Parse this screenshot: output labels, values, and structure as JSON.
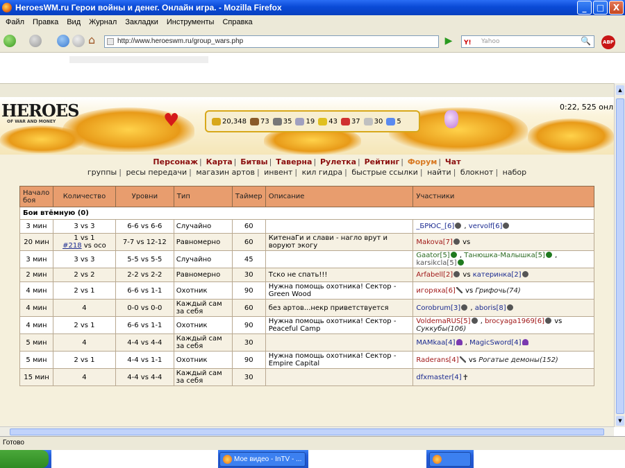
{
  "window": {
    "title": "HeroesWM.ru Герои войны и денег. Онлайн игра. - Mozilla Firefox",
    "buttons": [
      "_",
      "□",
      "X"
    ]
  },
  "menu": [
    "Файл",
    "Правка",
    "Вид",
    "Журнал",
    "Закладки",
    "Инструменты",
    "Справка"
  ],
  "navbar": {
    "url": "http://www.heroeswm.ru/group_wars.php",
    "search_engine": "Y!",
    "search_placeholder": "Yahoo",
    "abp_label": "ABP"
  },
  "game": {
    "logo": "HEROES",
    "logo_sub": "OF WAR AND MONEY",
    "clock": "0:22, 525 онл",
    "resources": [
      {
        "name": "gold",
        "value": "20,348",
        "color": "#d8a81a"
      },
      {
        "name": "wood",
        "value": "73",
        "color": "#8a5a2a"
      },
      {
        "name": "ore",
        "value": "35",
        "color": "#777777"
      },
      {
        "name": "mercury",
        "value": "19",
        "color": "#a0a0c0"
      },
      {
        "name": "sulfur",
        "value": "43",
        "color": "#e0c020"
      },
      {
        "name": "crystals",
        "value": "37",
        "color": "#d03030"
      },
      {
        "name": "gems",
        "value": "30",
        "color": "#c0c0c0"
      },
      {
        "name": "diamonds",
        "value": "5",
        "color": "#5a8af0"
      }
    ],
    "main_nav": [
      "Персонаж",
      "Карта",
      "Битвы",
      "Таверна",
      "Рулетка",
      "Рейтинг",
      "Форум",
      "Чат"
    ],
    "sub_nav": [
      "группы",
      "ресы передачи",
      "магазин артов",
      "инвент",
      "кил гидра",
      "быстрые ссылки",
      "найти",
      "блокнот",
      "набор"
    ]
  },
  "table": {
    "headers": [
      "Начало боя",
      "Количество",
      "Уровни",
      "Тип",
      "Таймер",
      "Описание",
      "Участники"
    ],
    "group_label": "Бои втёмную (0)",
    "rows": [
      {
        "start": "3 мин",
        "count": "3 vs 3",
        "levels": "6-6 vs 6-6",
        "type": "Случайно",
        "timer": "60",
        "desc": "",
        "parts": [
          {
            "t": "_БРЮС_[6]",
            "c": "pblue"
          },
          {
            "t": " , ",
            "c": ""
          },
          {
            "t": "vervolf[6]",
            "c": "pblue"
          }
        ]
      },
      {
        "start": "20 мин",
        "count": "1 vs 1",
        "count_link": "#218",
        "count_rest": "vs осо",
        "levels": "7-7 vs 12-12",
        "type": "Равномерно",
        "timer": "60",
        "desc": "КитенаГи и слави - нагло врут и воруют экогу",
        "parts": [
          {
            "t": "Makova[7]",
            "c": "pred"
          },
          {
            "t": " vs",
            "c": ""
          }
        ]
      },
      {
        "start": "3 мин",
        "count": "3 vs 3",
        "levels": "5-5 vs 5-5",
        "type": "Случайно",
        "timer": "45",
        "desc": "",
        "parts": [
          {
            "t": "Gaator[5]",
            "c": "pgreen"
          },
          {
            "t": " , ",
            "c": ""
          },
          {
            "t": "Танюшка-Малышка[5]",
            "c": "pgreen"
          },
          {
            "t": " , ",
            "c": ""
          },
          {
            "t": "karsikcla[5]",
            "c": "pgrey"
          }
        ]
      },
      {
        "start": "2 мин",
        "count": "2 vs 2",
        "levels": "2-2 vs 2-2",
        "type": "Равномерно",
        "timer": "30",
        "desc": "Тско не спать!!!",
        "parts": [
          {
            "t": "Arfabell[2]",
            "c": "pred"
          },
          {
            "t": " vs ",
            "c": ""
          },
          {
            "t": "катеринка[2]",
            "c": "pblue"
          }
        ]
      },
      {
        "start": "4 мин",
        "count": "2 vs 1",
        "levels": "6-6 vs 1-1",
        "type": "Охотник",
        "timer": "90",
        "desc": "Нужна помощь охотника! Сектор - Green Wood",
        "parts": [
          {
            "t": "игоряха[6]",
            "c": "pred"
          },
          {
            "t": " vs ",
            "c": ""
          },
          {
            "t": "Грифочь(74)",
            "c": "peng"
          }
        ]
      },
      {
        "start": "4 мин",
        "count": "4",
        "levels": "0-0 vs 0-0",
        "type": "Каждый сам за себя",
        "timer": "60",
        "desc": "без артов...некр приветствуется",
        "parts": [
          {
            "t": "Corobrum[3]",
            "c": "pblue"
          },
          {
            "t": " , ",
            "c": ""
          },
          {
            "t": "aboris[8]",
            "c": "pblue"
          }
        ]
      },
      {
        "start": "4 мин",
        "count": "2 vs 1",
        "levels": "6-6 vs 1-1",
        "type": "Охотник",
        "timer": "90",
        "desc": "Нужна помощь охотника! Сектор - Peaceful Camp",
        "parts": [
          {
            "t": "VoldemaRUS[5]",
            "c": "pred"
          },
          {
            "t": " , ",
            "c": ""
          },
          {
            "t": "brocyaga1969[6]",
            "c": "pred"
          },
          {
            "t": " vs ",
            "c": ""
          },
          {
            "t": "Суккубы(106)",
            "c": "peng"
          }
        ]
      },
      {
        "start": "5 мин",
        "count": "4",
        "levels": "4-4 vs 4-4",
        "type": "Каждый сам за себя",
        "timer": "30",
        "desc": "",
        "parts": [
          {
            "t": "MAMkaa[4]",
            "c": "pblue"
          },
          {
            "t": " , ",
            "c": ""
          },
          {
            "t": "MagicSword[4]",
            "c": "pblue"
          }
        ]
      },
      {
        "start": "5 мин",
        "count": "2 vs 1",
        "levels": "4-4 vs 1-1",
        "type": "Охотник",
        "timer": "90",
        "desc": "Нужна помощь охотника! Сектор - Empire Capital",
        "parts": [
          {
            "t": "Raderans[4]",
            "c": "pred"
          },
          {
            "t": " vs ",
            "c": ""
          },
          {
            "t": "Рогатые демоны(152)",
            "c": "peng"
          }
        ]
      },
      {
        "start": "15 мин",
        "count": "4",
        "levels": "4-4 vs 4-4",
        "type": "Каждый сам за себя",
        "timer": "30",
        "desc": "",
        "parts": [
          {
            "t": "dfxmaster[4]",
            "c": "pblue"
          }
        ]
      }
    ]
  },
  "status": "Готово",
  "taskbar": {
    "item": "Мое видео - InTV - ..."
  }
}
